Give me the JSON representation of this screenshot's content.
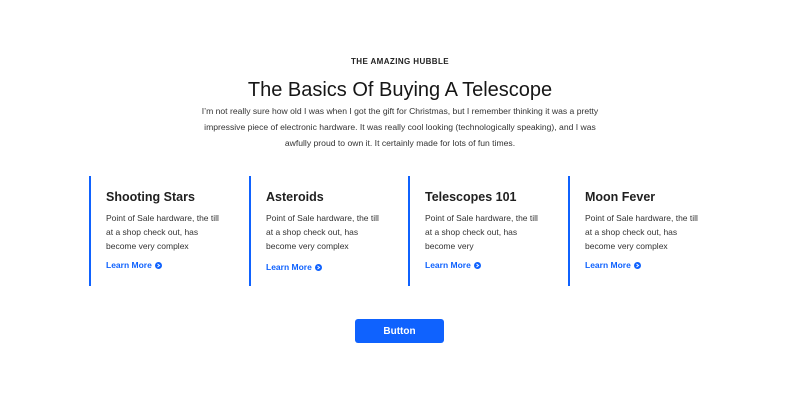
{
  "section": {
    "eyebrow": "THE AMAZING HUBBLE",
    "title": "The Basics Of Buying A Telescope",
    "intro": "I’m not really sure how old I was when I got the gift for Christmas, but I remember thinking it was a pretty impressive piece of electronic hardware. It was really cool looking (technologically speaking), and I was awfully proud to own it. It certainly made for lots of fun times."
  },
  "cards": [
    {
      "title": "Shooting Stars",
      "body": "Point of Sale hardware, the till at a shop check out, has become very complex",
      "link": "Learn More",
      "icon": "arrow-circle-right-icon"
    },
    {
      "title": "Asteroids",
      "body": "Point of Sale hardware, the till at a shop check out, has become very complex",
      "link": "Learn More",
      "icon": "arrow-circle-right-icon"
    },
    {
      "title": "Telescopes 101",
      "body": "Point of Sale hardware, the till at a shop check out, has become very",
      "link": "Learn More",
      "icon": "arrow-circle-right-icon"
    },
    {
      "title": "Moon Fever",
      "body": "Point of Sale hardware, the till at a shop check out, has become very complex",
      "link": "Learn More",
      "icon": "arrow-circle-right-icon"
    }
  ],
  "button": {
    "label": "Button"
  },
  "colors": {
    "accent": "#0f62fe",
    "text": "#1f1f1f",
    "background": "#ffffff"
  }
}
